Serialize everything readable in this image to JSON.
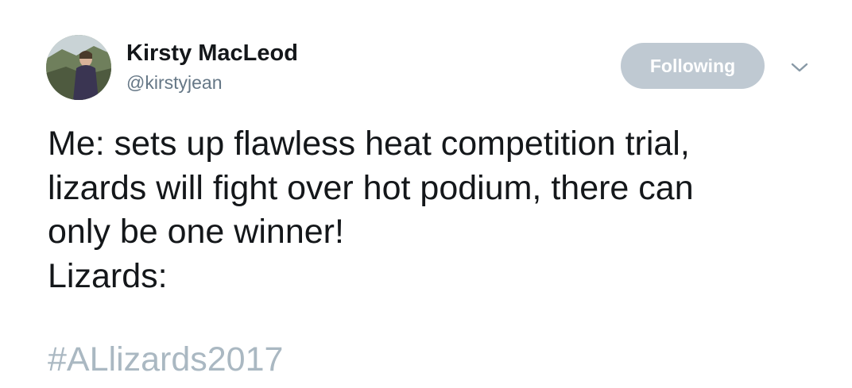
{
  "author": {
    "display_name": "Kirsty MacLeod",
    "handle": "@kirstyjean",
    "avatar_icon": "profile-photo"
  },
  "actions": {
    "follow_label": "Following",
    "menu_icon": "chevron-down-icon"
  },
  "tweet": {
    "lines": [
      "Me: sets up flawless heat competition trial,",
      "lizards will fight over hot podium, there can",
      "only be one winner!",
      "Lizards:"
    ],
    "hashtag": "#ALlizards2017"
  },
  "colors": {
    "text": "#14171a",
    "secondary": "#657786",
    "button_bg": "#bfc9d2",
    "hashtag": "#aab8c2"
  }
}
